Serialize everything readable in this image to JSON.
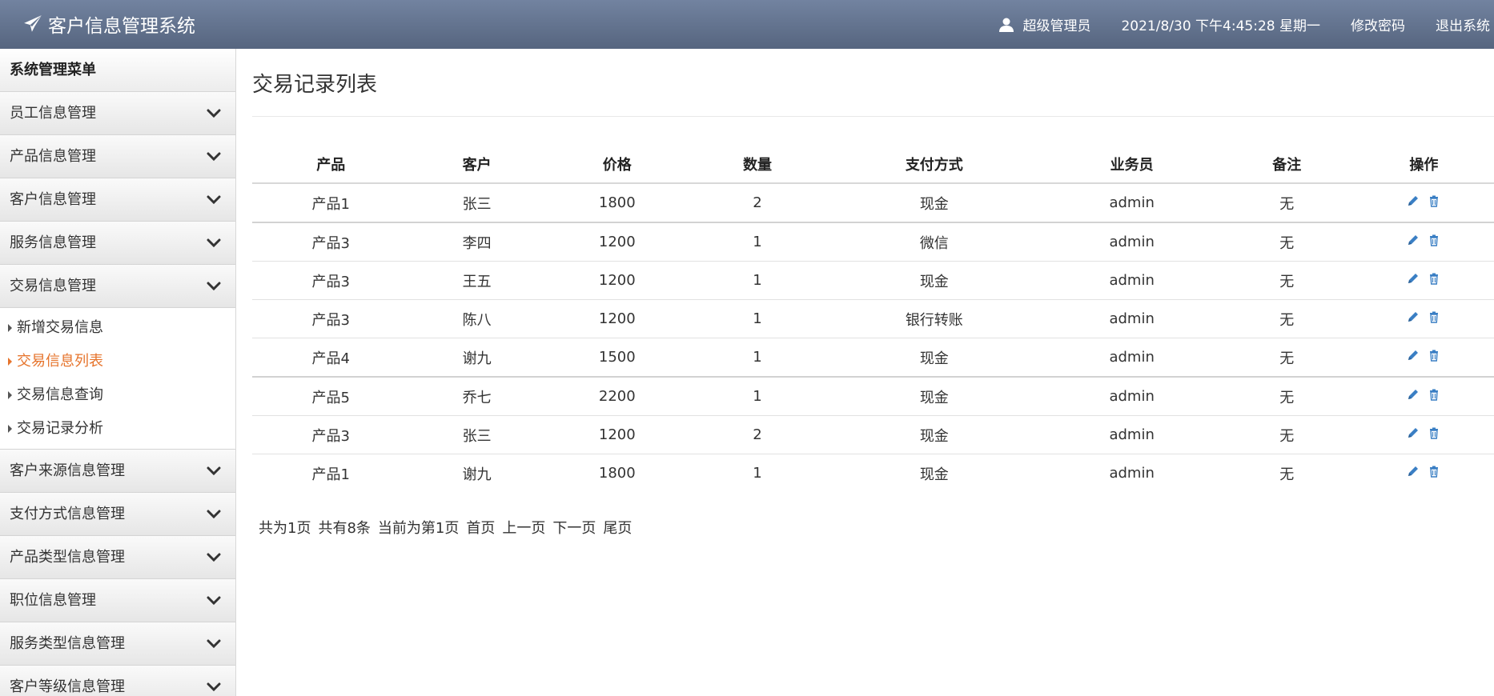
{
  "header": {
    "title": "客户信息管理系统",
    "user": "超级管理员",
    "datetime": "2021/8/30 下午4:45:28 星期一",
    "change_password": "修改密码",
    "logout": "退出系统"
  },
  "sidebar": {
    "title": "系统管理菜单",
    "items_before": [
      {
        "label": "员工信息管理"
      },
      {
        "label": "产品信息管理"
      },
      {
        "label": "客户信息管理"
      },
      {
        "label": "服务信息管理"
      },
      {
        "label": "交易信息管理"
      }
    ],
    "subitems": [
      {
        "label": "新增交易信息"
      },
      {
        "label": "交易信息列表"
      },
      {
        "label": "交易信息查询"
      },
      {
        "label": "交易记录分析"
      }
    ],
    "items_after": [
      {
        "label": "客户来源信息管理"
      },
      {
        "label": "支付方式信息管理"
      },
      {
        "label": "产品类型信息管理"
      },
      {
        "label": "职位信息管理"
      },
      {
        "label": "服务类型信息管理"
      },
      {
        "label": "客户等级信息管理"
      }
    ]
  },
  "main": {
    "title": "交易记录列表",
    "table": {
      "columns": [
        "产品",
        "客户",
        "价格",
        "数量",
        "支付方式",
        "业务员",
        "备注",
        "操作"
      ],
      "rows": [
        [
          "产品1",
          "张三",
          "1800",
          "2",
          "现金",
          "admin",
          "无"
        ],
        [
          "产品3",
          "李四",
          "1200",
          "1",
          "微信",
          "admin",
          "无"
        ],
        [
          "产品3",
          "王五",
          "1200",
          "1",
          "现金",
          "admin",
          "无"
        ],
        [
          "产品3",
          "陈八",
          "1200",
          "1",
          "银行转账",
          "admin",
          "无"
        ],
        [
          "产品4",
          "谢九",
          "1500",
          "1",
          "现金",
          "admin",
          "无"
        ],
        [
          "产品5",
          "乔七",
          "2200",
          "1",
          "现金",
          "admin",
          "无"
        ],
        [
          "产品3",
          "张三",
          "1200",
          "2",
          "现金",
          "admin",
          "无"
        ],
        [
          "产品1",
          "谢九",
          "1800",
          "1",
          "现金",
          "admin",
          "无"
        ]
      ]
    },
    "pager": {
      "total_pages": "共为1页",
      "total_records": "共有8条",
      "current": "当前为第1页",
      "first": "首页",
      "prev": "上一页",
      "next": "下一页",
      "last": "尾页"
    }
  },
  "colors": {
    "header_bg": "#5f6e89",
    "active_menu": "#e6742c",
    "action_icon": "#3a7fc4"
  },
  "icons": {
    "brand": "paper-plane-icon",
    "user": "user-icon",
    "menu_toggle": "chevron-down-icon",
    "edit": "pencil-icon",
    "delete": "trash-icon"
  }
}
